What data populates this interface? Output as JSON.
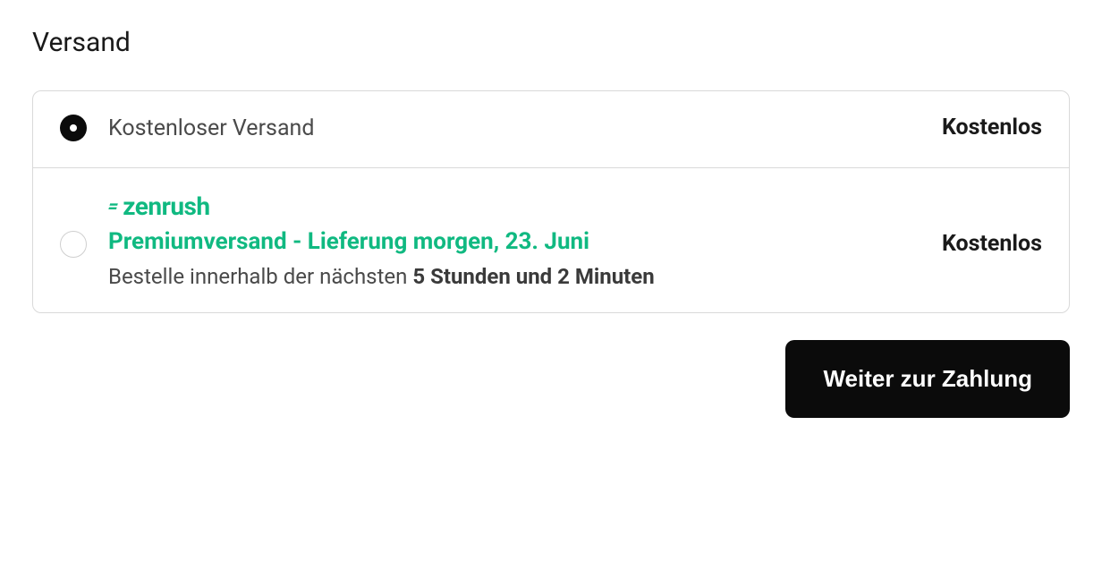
{
  "section": {
    "title": "Versand"
  },
  "options": [
    {
      "label": "Kostenloser Versand",
      "price": "Kostenlos",
      "selected": true
    },
    {
      "brand": "zenrush",
      "title": "Premiumversand - Lieferung morgen, 23. Juni",
      "countdown_prefix": "Bestelle innerhalb der nächsten ",
      "countdown_value": "5 Stunden und 2 Minuten",
      "price": "Kostenlos",
      "selected": false
    }
  ],
  "actions": {
    "continue_label": "Weiter zur Zahlung"
  }
}
